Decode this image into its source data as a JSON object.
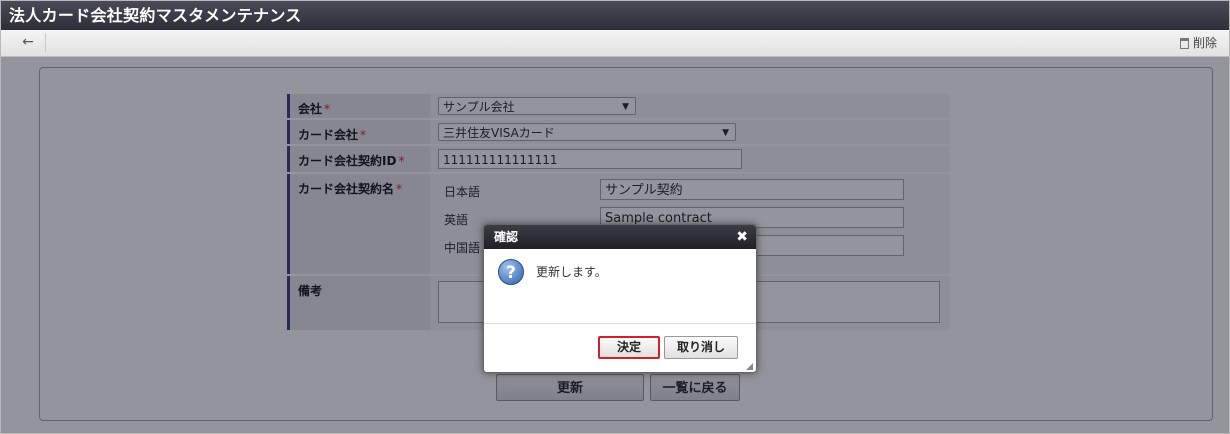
{
  "window": {
    "title": "法人カード会社契約マスタメンテナンス"
  },
  "toolbar": {
    "back_icon": "←",
    "delete_label": "削除"
  },
  "form": {
    "required_mark": "*",
    "company": {
      "label": "会社",
      "value": "サンプル会社"
    },
    "card_company": {
      "label": "カード会社",
      "value": "三井住友VISAカード"
    },
    "contract_id": {
      "label": "カード会社契約ID",
      "value": "111111111111111"
    },
    "contract_name": {
      "label": "カード会社契約名",
      "langs": [
        {
          "label": "日本語",
          "value": "サンプル契約"
        },
        {
          "label": "英語",
          "value": "Sample contract"
        },
        {
          "label": "中国語",
          "value": ""
        }
      ]
    },
    "memo": {
      "label": "備考",
      "value": ""
    }
  },
  "actions": {
    "update_label": "更新",
    "back_to_list_label": "一覧に戻る"
  },
  "dialog": {
    "title": "確認",
    "close_icon": "✖",
    "question_icon": "?",
    "message": "更新します。",
    "ok_label": "決定",
    "cancel_label": "取り消し"
  },
  "colors": {
    "title_bar": "#2e2e3a",
    "label_accent": "#3b4a8c",
    "highlight": "#d0202e"
  }
}
